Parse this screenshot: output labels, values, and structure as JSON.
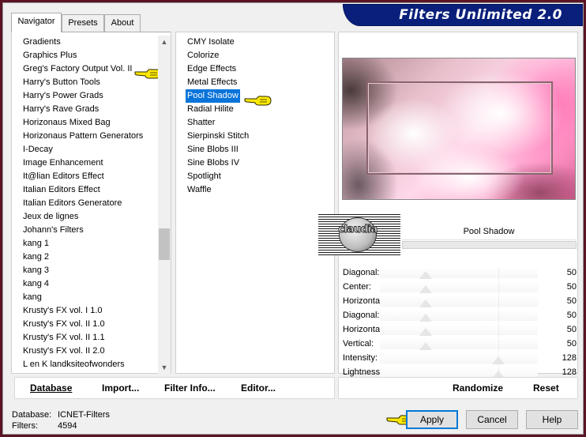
{
  "window": {
    "title": "Filters Unlimited 2.0"
  },
  "tabs": [
    {
      "label": "Navigator",
      "active": true
    },
    {
      "label": "Presets",
      "active": false
    },
    {
      "label": "About",
      "active": false
    }
  ],
  "categories": [
    "Gradients",
    "Graphics Plus",
    "Greg's Factory Output Vol. II",
    "Harry's Button Tools",
    "Harry's Power Grads",
    "Harry's Rave Grads",
    "Horizonaus Mixed Bag",
    "Horizonaus Pattern Generators",
    "I-Decay",
    "Image Enhancement",
    "It@lian Editors Effect",
    "Italian Editors Effect",
    "Italian Editors Generatore",
    "Jeux de lignes",
    "Johann's Filters",
    "kang 1",
    "kang 2",
    "kang 3",
    "kang 4",
    "kang",
    "Krusty's FX vol. I 1.0",
    "Krusty's FX vol. II 1.0",
    "Krusty's FX vol. II 1.1",
    "Krusty's FX vol. II 2.0",
    "L en K landksiteofwonders"
  ],
  "selected_category": "Greg's Factory Output Vol. II",
  "filters": [
    "CMY Isolate",
    "Colorize",
    "Edge Effects",
    "Metal Effects",
    "Pool Shadow",
    "Radial Hilite",
    "Shatter",
    "Sierpinski Stitch",
    "Sine Blobs III",
    "Sine Blobs IV",
    "Spotlight",
    "Waffle"
  ],
  "selected_filter": "Pool Shadow",
  "preview": {
    "filter_name": "Pool Shadow",
    "logo_text": "claudia"
  },
  "sliders": [
    {
      "label": "Diagonal:",
      "value": 50
    },
    {
      "label": "Center:",
      "value": 50
    },
    {
      "label": "Horizontal:",
      "value": 50
    },
    {
      "label": "Diagonal:",
      "value": 50
    },
    {
      "label": "Horizontal:",
      "value": 50
    },
    {
      "label": "Vertical:",
      "value": 50
    },
    {
      "label": "Intensity:",
      "value": 128
    },
    {
      "label": "Lightness:",
      "value": 128
    }
  ],
  "toolbar_left": {
    "database": "Database",
    "import": "Import...",
    "filter_info": "Filter Info...",
    "editor": "Editor..."
  },
  "toolbar_right": {
    "randomize": "Randomize",
    "reset": "Reset"
  },
  "status": {
    "database_label": "Database:",
    "database_value": "ICNET-Filters",
    "filters_label": "Filters:",
    "filters_value": "4594"
  },
  "buttons": {
    "apply": "Apply",
    "cancel": "Cancel",
    "help": "Help"
  },
  "colors": {
    "banner": "#0a1f7a",
    "selection": "#0a74da",
    "background": "#5a1424"
  }
}
